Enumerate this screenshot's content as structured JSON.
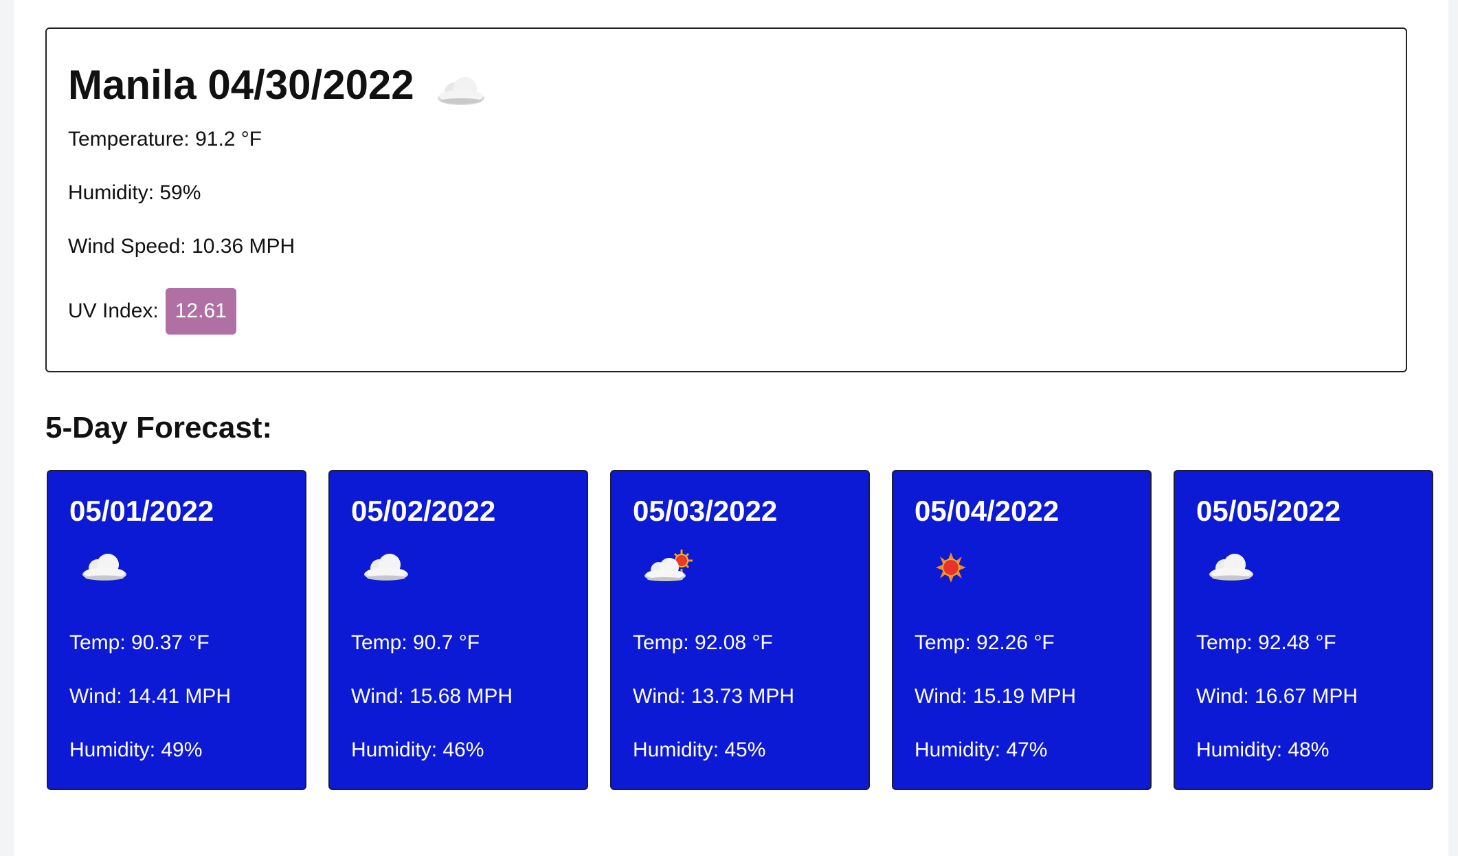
{
  "current": {
    "title": "Manila 04/30/2022",
    "icon": "cloud-icon",
    "temperature": "Temperature: 91.2 °F",
    "humidity": "Humidity: 59%",
    "wind": "Wind Speed: 10.36 MPH",
    "uv_label": "UV Index:",
    "uv_value": "12.61",
    "uv_color": "#b070a4"
  },
  "forecast": {
    "heading": "5-Day Forecast:",
    "card_color": "#0c1ad6",
    "days": [
      {
        "date": "05/01/2022",
        "icon": "cloud-icon",
        "temp": "Temp: 90.37 °F",
        "wind": "Wind: 14.41 MPH",
        "humidity": "Humidity: 49%"
      },
      {
        "date": "05/02/2022",
        "icon": "cloud-icon",
        "temp": "Temp: 90.7 °F",
        "wind": "Wind: 15.68 MPH",
        "humidity": "Humidity: 46%"
      },
      {
        "date": "05/03/2022",
        "icon": "cloud-sun-icon",
        "temp": "Temp: 92.08 °F",
        "wind": "Wind: 13.73 MPH",
        "humidity": "Humidity: 45%"
      },
      {
        "date": "05/04/2022",
        "icon": "sun-icon",
        "temp": "Temp: 92.26 °F",
        "wind": "Wind: 15.19 MPH",
        "humidity": "Humidity: 47%"
      },
      {
        "date": "05/05/2022",
        "icon": "cloud-icon",
        "temp": "Temp: 92.48 °F",
        "wind": "Wind: 16.67 MPH",
        "humidity": "Humidity: 48%"
      }
    ]
  }
}
